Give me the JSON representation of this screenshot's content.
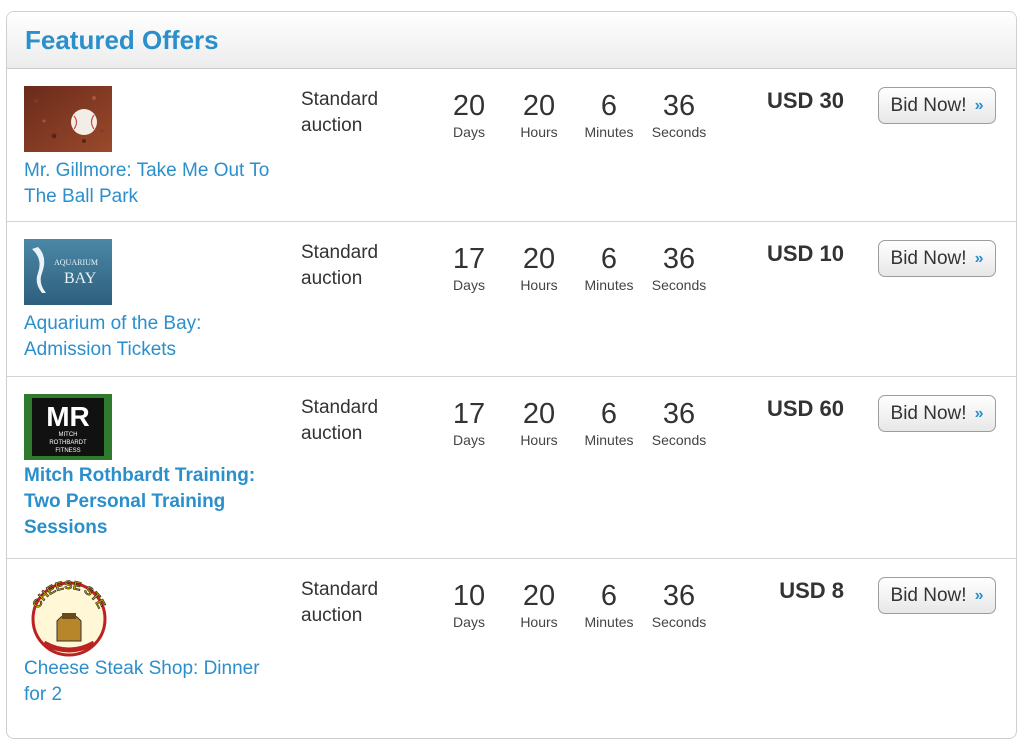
{
  "header": {
    "title": "Featured Offers"
  },
  "offers": [
    {
      "title": "Mr. Gillmore: Take Me Out To The Ball Park",
      "type_line1": "Standard",
      "type_line2": "auction",
      "days": "20",
      "hours": "20",
      "minutes": "6",
      "seconds": "36",
      "price": "USD 30",
      "bid_label": "Bid Now!"
    },
    {
      "title": "Aquarium of the Bay: Admission Tickets",
      "image_text_1": "AQUARIUM",
      "image_text_2": "BAY",
      "type_line1": "Standard",
      "type_line2": "auction",
      "days": "17",
      "hours": "20",
      "minutes": "6",
      "seconds": "36",
      "price": "USD 10",
      "bid_label": "Bid Now!"
    },
    {
      "title": "Mitch Rothbardt Training: Two Personal Training Sessions",
      "image_text_1": "MR",
      "image_text_2": "MITCH",
      "image_text_3": "ROTHBARDT",
      "image_text_4": "FITNESS",
      "type_line1": "Standard",
      "type_line2": "auction",
      "days": "17",
      "hours": "20",
      "minutes": "6",
      "seconds": "36",
      "price": "USD 60",
      "bid_label": "Bid Now!"
    },
    {
      "title": "Cheese Steak Shop: Dinner for 2",
      "image_text_1": "CHEESE STEAK",
      "type_line1": "Standard",
      "type_line2": "auction",
      "days": "10",
      "hours": "20",
      "minutes": "6",
      "seconds": "36",
      "price": "USD 8",
      "bid_label": "Bid Now!"
    }
  ],
  "labels": {
    "days": "Days",
    "hours": "Hours",
    "minutes": "Minutes",
    "seconds": "Seconds"
  },
  "colors": {
    "accent": "#2b8fcb",
    "text": "#333333",
    "border": "#d3d3d3"
  },
  "icons": {
    "bid_arrow": "double-chevron-right-icon"
  }
}
